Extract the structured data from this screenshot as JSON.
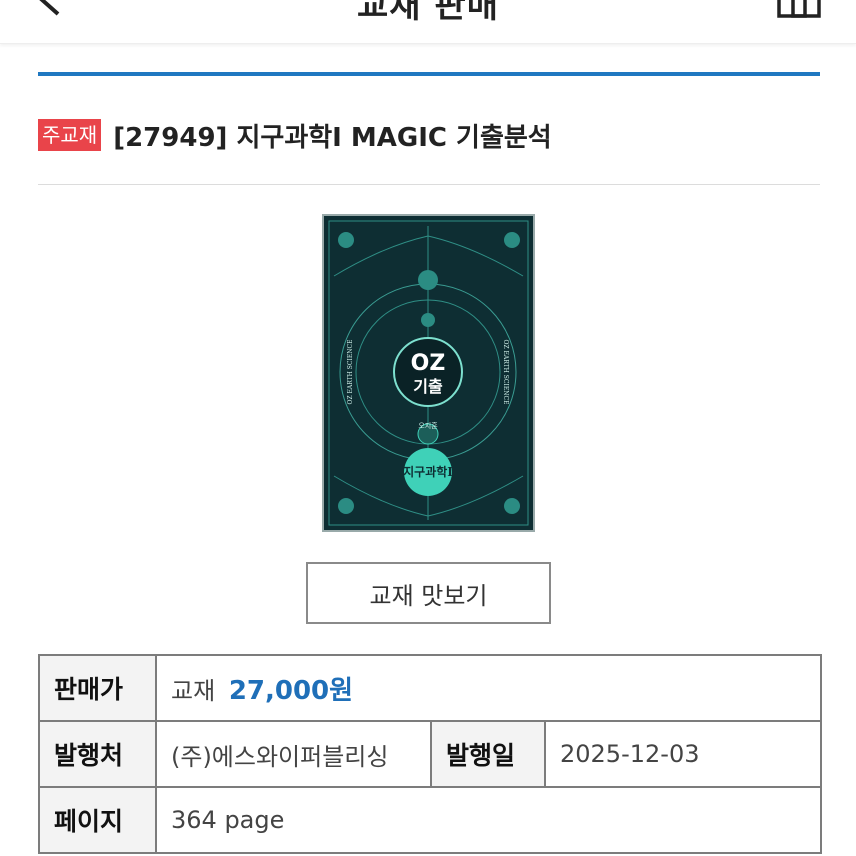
{
  "header": {
    "title": "교재 판매",
    "back_icon": "chevron-left-icon",
    "home_icon": "home-icon"
  },
  "product": {
    "tag": "주교재",
    "title": "[27949] 지구과학I MAGIC 기출분석",
    "cover": {
      "title_line1": "OZ",
      "title_line2": "기출",
      "ring_text": "OZ EARTH SCIENCE",
      "author": "오지훈",
      "subject": "지구과학Ⅰ"
    },
    "preview_button": "교재 맛보기"
  },
  "info": {
    "price_label": "판매가",
    "price_prefix": "교재",
    "price_value": "27,000원",
    "publisher_label": "발행처",
    "publisher_value": "(주)에스와이퍼블리싱",
    "date_label": "발행일",
    "date_value": "2025-12-03",
    "pages_label": "페이지",
    "pages_value": "364 page"
  },
  "colors": {
    "accent_blue": "#1f78c1",
    "price_blue": "#1f6fb8",
    "tag_red": "#e9444a",
    "cover_bg": "#0e2e33",
    "cover_line": "#3fd1b8"
  }
}
